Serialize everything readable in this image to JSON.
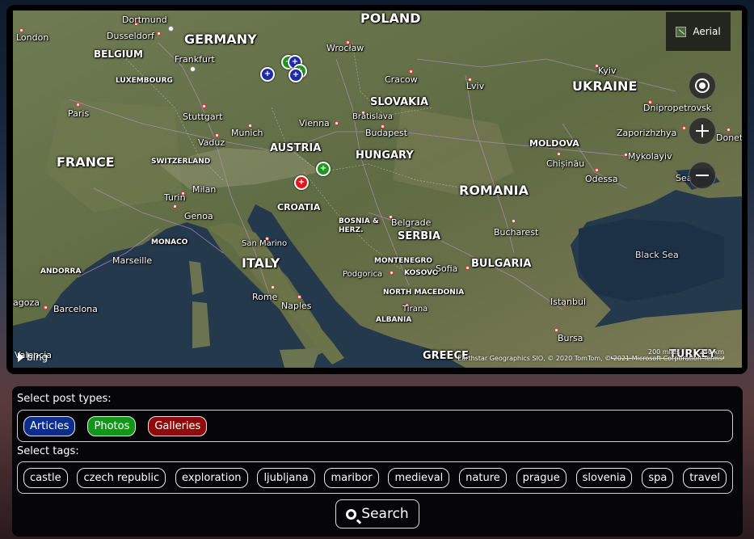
{
  "map": {
    "view_label": "Aerial",
    "provider": "bing",
    "copyright": "Earthstar Geographics SIO, © 2020 TomTom, © 2021 Microsoft Corporation Terms",
    "scale_miles": "200 miles",
    "scale_km": "250 km",
    "countries": {
      "poland": "POLAND",
      "germany": "GERMANY",
      "belgium": "BELGIUM",
      "luxembourg": "LUXEMBOURG",
      "france": "FRANCE",
      "switzerland": "SWITZERLAND",
      "austria": "AUSTRIA",
      "slovakia": "SLOVAKIA",
      "hungary": "HUNGARY",
      "ukraine": "UKRAINE",
      "moldova": "MOLDOVA",
      "romania": "ROMANIA",
      "croatia": "CROATIA",
      "bosnia": "BOSNIA &\nHERZ.",
      "serbia": "SERBIA",
      "monaco": "MONACO",
      "italy": "ITALY",
      "andorra": "ANDORRA",
      "montenegro": "MONTENEGRO",
      "kosovo": "KOSOVO",
      "north_macedonia": "NORTH MACEDONIA",
      "bulgaria": "BULGARIA",
      "albania": "ALBANIA",
      "greece": "GREECE",
      "turkey": "TURKEY"
    },
    "cities": {
      "london": "London",
      "dortmund": "Dortmund",
      "dusseldorf": "Dusseldorf",
      "frankfurt": "Frankfurt",
      "wroclaw": "Wrocław",
      "kyiv": "Kyiv",
      "cracow": "Cracow",
      "lviv": "Lviv",
      "paris": "Paris",
      "stuttgart": "Stuttgart",
      "vienna": "Vienna",
      "bratislava": "Bratislava",
      "dnipropetrovsk": "Dnipropetrovsk",
      "munich": "Munich",
      "budapest": "Budapest",
      "zaporizhzhya": "Zaporizhzhya",
      "vaduz": "Vaduz",
      "chisinau": "Chișinău",
      "mykolayiv": "Mykolayiv",
      "donets": "Donets",
      "odessa": "Odessa",
      "milan": "Milan",
      "turin": "Turin",
      "genoa": "Genoa",
      "belgrade": "Belgrade",
      "bucharest": "Bucharest",
      "san_marino": "San Marino",
      "marseille": "Marseille",
      "sofia": "Sofia",
      "podgorica": "Podgorica",
      "rome": "Rome",
      "saragossa": "agoza",
      "barcelona": "Barcelona",
      "naples": "Naples",
      "tirana": "Tirana",
      "istanbul": "Istanbul",
      "bursa": "Bursa",
      "valencia": "Valencia"
    },
    "seas": {
      "black_sea": "Black Sea",
      "sea_of_azov": "Sea"
    }
  },
  "filters": {
    "post_types_label": "Select post types:",
    "post_types": [
      "Articles",
      "Photos",
      "Galleries"
    ],
    "tags_label": "Select tags:",
    "tags": [
      "castle",
      "czech republic",
      "exploration",
      "ljubljana",
      "maribor",
      "medieval",
      "nature",
      "prague",
      "slovenia",
      "spa",
      "travel"
    ],
    "search_label": "Search"
  },
  "colors": {
    "articles": "#0b2d8e",
    "photos": "#11961a",
    "galleries": "#8f0b0b",
    "panel_bg": "#060608"
  },
  "icons": [
    "locate-icon",
    "zoom-in-icon",
    "zoom-out-icon",
    "aerial-icon",
    "bing-logo-icon",
    "search-icon"
  ]
}
